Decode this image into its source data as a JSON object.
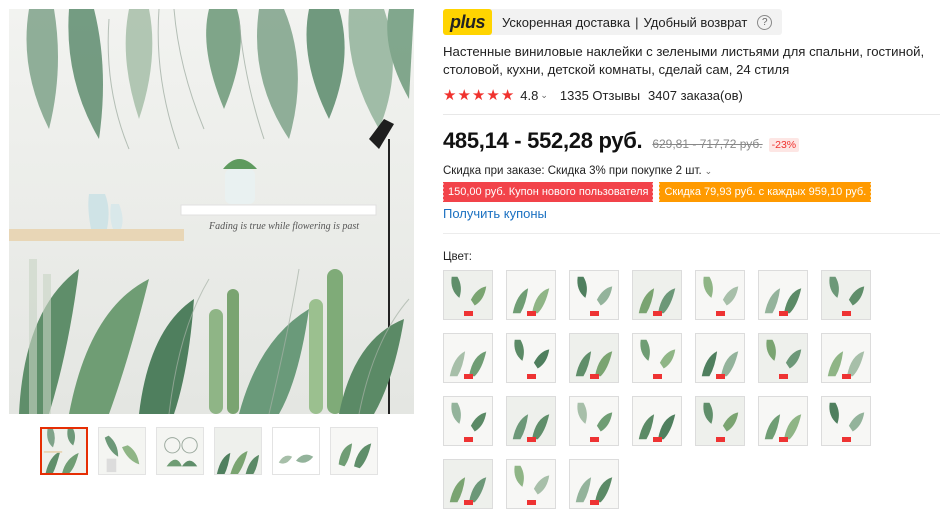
{
  "product": {
    "main_image": "green-tropical-leaves-wall-sticker-photo",
    "image_caption": "Fading is true while flowering is past",
    "thumbnails": [
      "variant-thumb",
      "variant-thumb",
      "variant-thumb",
      "variant-thumb",
      "variant-thumb",
      "variant-thumb"
    ],
    "promo": {
      "badge": "plus",
      "fast_delivery": "Ускоренная доставка",
      "separator": "|",
      "easy_return": "Удобный возврат",
      "help_icon": "?"
    },
    "title": "Настенные виниловые наклейки с зелеными листьями для спальни, гостиной, столовой, кухни, детской комнаты, сделай сам, 24 стиля",
    "rating": {
      "stars": 5,
      "value": "4.8",
      "caret": "⌄",
      "reviews": "1335 Отзывы",
      "orders": "3407 заказа(ов)"
    },
    "price": {
      "current": "485,14 - 552,28 руб.",
      "old": "629,81 - 717,72 руб.",
      "discount": "-23%"
    },
    "order_discount": "Скидка при заказе: Скидка 3% при покупке 2 шт.",
    "coupons": [
      "150,00 руб. Купон нового пользователя",
      "Скидка 79,93 руб. с каждых 959,10 руб."
    ],
    "get_coupons": "Получить купоны",
    "color_label": "Цвет:",
    "color_count": 24
  },
  "colors": {
    "accent_red": "#f0322e",
    "plus_yellow": "#ffd400",
    "link_blue": "#1a70c1",
    "coupon_red": "#f2434a",
    "coupon_orange": "#ff9a00"
  }
}
